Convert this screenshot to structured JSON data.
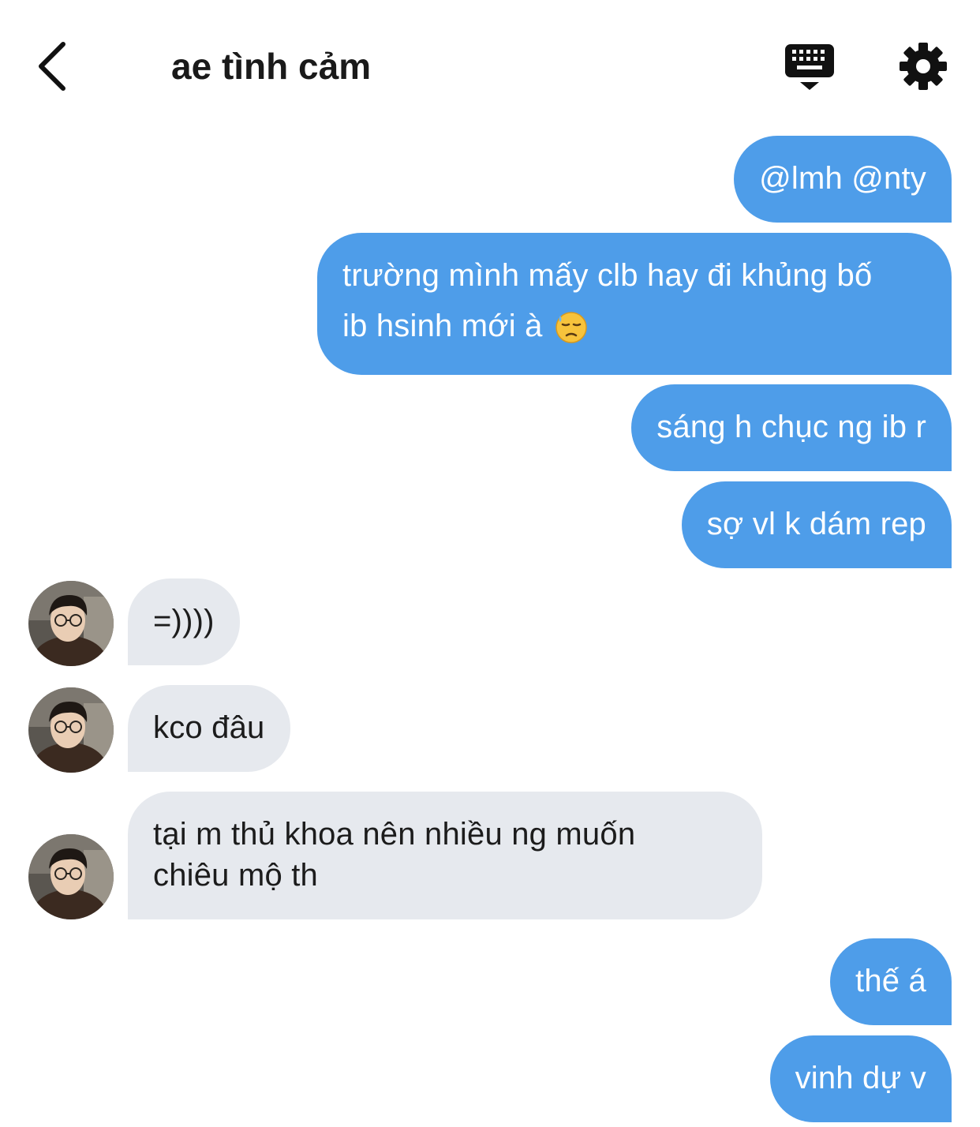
{
  "header": {
    "title": "ae tình cảm",
    "icons": [
      "chevron-left-icon",
      "keyboard-icon",
      "gear-icon"
    ]
  },
  "colors": {
    "outgoing_bubble": "#4e9de9",
    "incoming_bubble": "#e6e9ee",
    "outgoing_text": "#ffffff",
    "incoming_text": "#1c1c1c"
  },
  "messages": [
    {
      "direction": "out",
      "text": "@lmh @nty"
    },
    {
      "direction": "out",
      "line1": "trường mình mấy clb hay đi khủng bố",
      "line2": "ib hsinh mới à",
      "emoji": "downcast-face-with-sweat-emoji"
    },
    {
      "direction": "out",
      "text": "sáng h chục ng ib r"
    },
    {
      "direction": "out",
      "text": "sợ vl k dám rep"
    },
    {
      "direction": "in",
      "text": "=))))"
    },
    {
      "direction": "in",
      "text": "kco đâu"
    },
    {
      "direction": "in",
      "line1": "tại m thủ khoa nên nhiều ng muốn",
      "line2": "chiêu mộ th"
    },
    {
      "direction": "out",
      "text": "thế á"
    },
    {
      "direction": "out",
      "text": "vinh dự v"
    }
  ]
}
